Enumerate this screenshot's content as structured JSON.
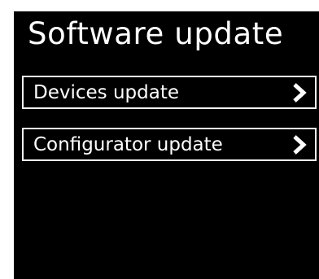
{
  "screen": {
    "title": "Software update",
    "background_color": "#000000",
    "text_color": "#ffffff"
  },
  "menu": {
    "items": [
      {
        "label": "Devices update",
        "icon": "chevron-right-icon"
      },
      {
        "label": "Configurator update",
        "icon": "chevron-right-icon"
      }
    ]
  }
}
